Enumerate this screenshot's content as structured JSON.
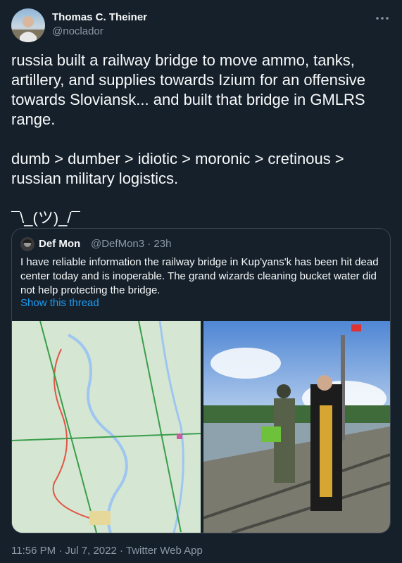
{
  "author": {
    "name": "Thomas C. Theiner",
    "handle": "@noclador"
  },
  "tweet": {
    "text": "russia built a railway bridge to move ammo, tanks, artillery, and supplies towards Izium for an offensive towards Sloviansk... and built that bridge in GMLRS range.\n\ndumb > dumber > idiotic > moronic > cretinous > russian military logistics.\n\n¯\\_(ツ)_/¯"
  },
  "quote": {
    "name": "Def Mon",
    "handle_time": "@DefMon3 · 23h",
    "text": "I have reliable information the railway bridge in Kup'yans'k has been hit dead center today and is inoperable. The grand wizards cleaning bucket water did not help protecting the bridge.",
    "show_thread": "Show this thread"
  },
  "footer": {
    "meta": "11:56 PM · Jul 7, 2022 · Twitter Web App"
  },
  "icons": {
    "more": "more-horizontal-icon"
  },
  "colors": {
    "background": "#15202b",
    "text": "#f7f9f9",
    "secondary": "#8b98a5",
    "link": "#1d9bf0",
    "border": "#38444d"
  }
}
